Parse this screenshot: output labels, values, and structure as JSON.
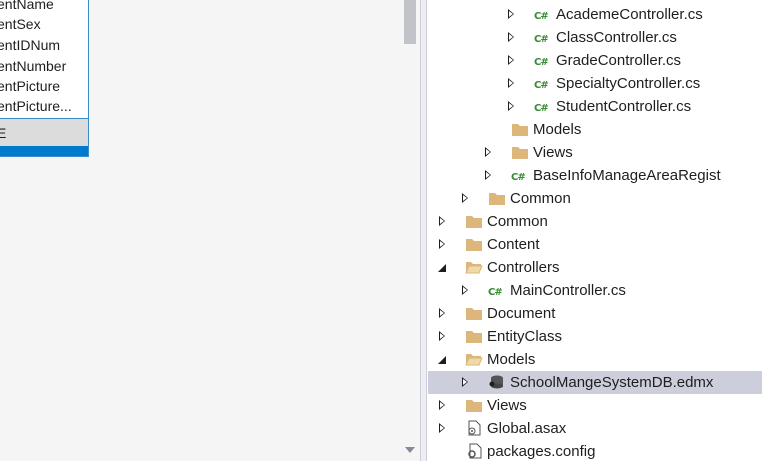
{
  "entity_box": {
    "properties": [
      "entName",
      "entSex",
      "entIDNum",
      "entNumber",
      "entPicture",
      "entPicture..."
    ],
    "nav_header": "E"
  },
  "tree": {
    "rows": [
      {
        "label": "AcademeController.cs",
        "icon": "csharp-file-icon",
        "expander": "collapsed"
      },
      {
        "label": "ClassController.cs",
        "icon": "csharp-file-icon",
        "expander": "collapsed"
      },
      {
        "label": "GradeController.cs",
        "icon": "csharp-file-icon",
        "expander": "collapsed"
      },
      {
        "label": "SpecialtyController.cs",
        "icon": "csharp-file-icon",
        "expander": "collapsed"
      },
      {
        "label": "StudentController.cs",
        "icon": "csharp-file-icon",
        "expander": "collapsed"
      },
      {
        "label": "Models",
        "icon": "folder-icon",
        "expander": "none"
      },
      {
        "label": "Views",
        "icon": "folder-icon",
        "expander": "collapsed"
      },
      {
        "label": "BaseInfoManageAreaRegist",
        "icon": "csharp-file-icon",
        "expander": "collapsed"
      },
      {
        "label": "Common",
        "icon": "folder-icon",
        "expander": "collapsed"
      },
      {
        "label": "Common",
        "icon": "folder-icon",
        "expander": "collapsed"
      },
      {
        "label": "Content",
        "icon": "folder-icon",
        "expander": "collapsed"
      },
      {
        "label": "Controllers",
        "icon": "folder-open-icon",
        "expander": "expanded"
      },
      {
        "label": "MainController.cs",
        "icon": "csharp-file-icon",
        "expander": "collapsed"
      },
      {
        "label": "Document",
        "icon": "folder-icon",
        "expander": "collapsed"
      },
      {
        "label": "EntityClass",
        "icon": "folder-icon",
        "expander": "collapsed"
      },
      {
        "label": "Models",
        "icon": "folder-open-icon",
        "expander": "expanded"
      },
      {
        "label": "SchoolMangeSystemDB.edmx",
        "icon": "edmx-file-icon",
        "expander": "collapsed",
        "selected": true
      },
      {
        "label": "Views",
        "icon": "folder-icon",
        "expander": "collapsed"
      },
      {
        "label": "Global.asax",
        "icon": "asax-file-icon",
        "expander": "collapsed"
      },
      {
        "label": "packages.config",
        "icon": "config-file-icon",
        "expander": "none"
      }
    ]
  },
  "colors": {
    "accent": "#007acc",
    "folder": "#dcb67a",
    "csharp": "#388a34",
    "selection": "#cccedb"
  }
}
